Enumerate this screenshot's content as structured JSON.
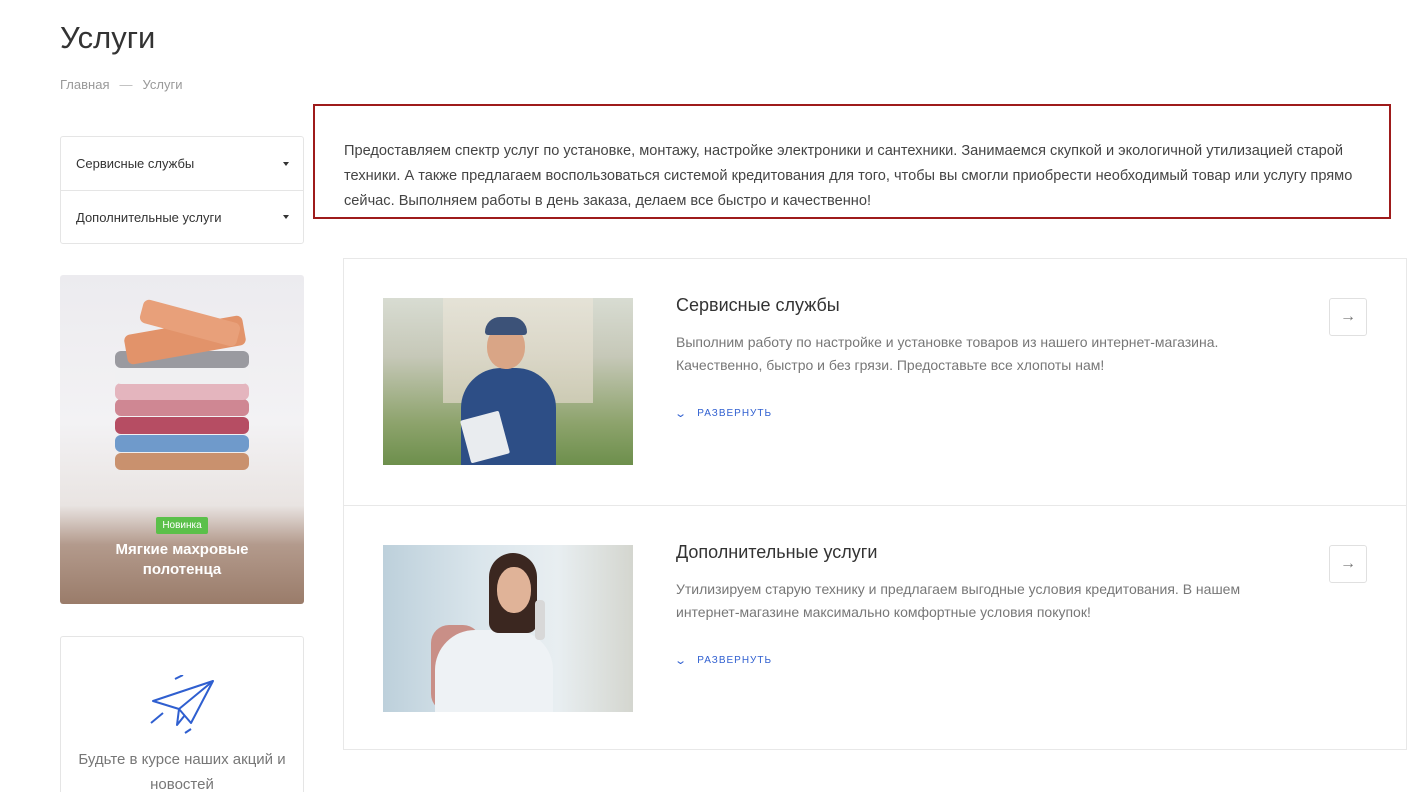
{
  "page": {
    "title": "Услуги",
    "breadcrumb": [
      "Главная",
      "—",
      "Услуги"
    ]
  },
  "sidebar": {
    "menu": [
      {
        "label": "Сервисные службы"
      },
      {
        "label": "Дополнительные услуги"
      }
    ],
    "promo": {
      "badge": "Новинка",
      "title": "Мягкие махровые полотенца"
    },
    "subscribe": {
      "text": "Будьте в курсе наших акций и новостей",
      "icon": "paper-plane-icon"
    }
  },
  "intro": {
    "text": "Предоставляем спектр услуг по установке, монтажу, настройке электроники и сантехники. Занимаемся скупкой и экологичной утилизацией старой техники. А также предлагаем воспользоваться системой кредитования для того, чтобы вы смогли приобрести необходимый товар или услугу прямо сейчас. Выполняем работы в день заказа, делаем все быстро и качественно!"
  },
  "services": [
    {
      "title": "Сервисные службы",
      "description": "Выполним работу по настройке и установке товаров из нашего интернет-магазина. Качественно, быстро и без грязи. Предоставьте все хлопоты нам!",
      "expand_label": "РАЗВЕРНУТЬ"
    },
    {
      "title": "Дополнительные услуги",
      "description": "Утилизируем старую технику и предлагаем выгодные условия кредитования. В нашем интернет-магазине максимально комфортные условия покупок!",
      "expand_label": "РАЗВЕРНУТЬ"
    }
  ],
  "colors": {
    "accent": "#2f5fd0",
    "intro_border": "#9e1b1b",
    "badge_green": "#5bc04a"
  }
}
